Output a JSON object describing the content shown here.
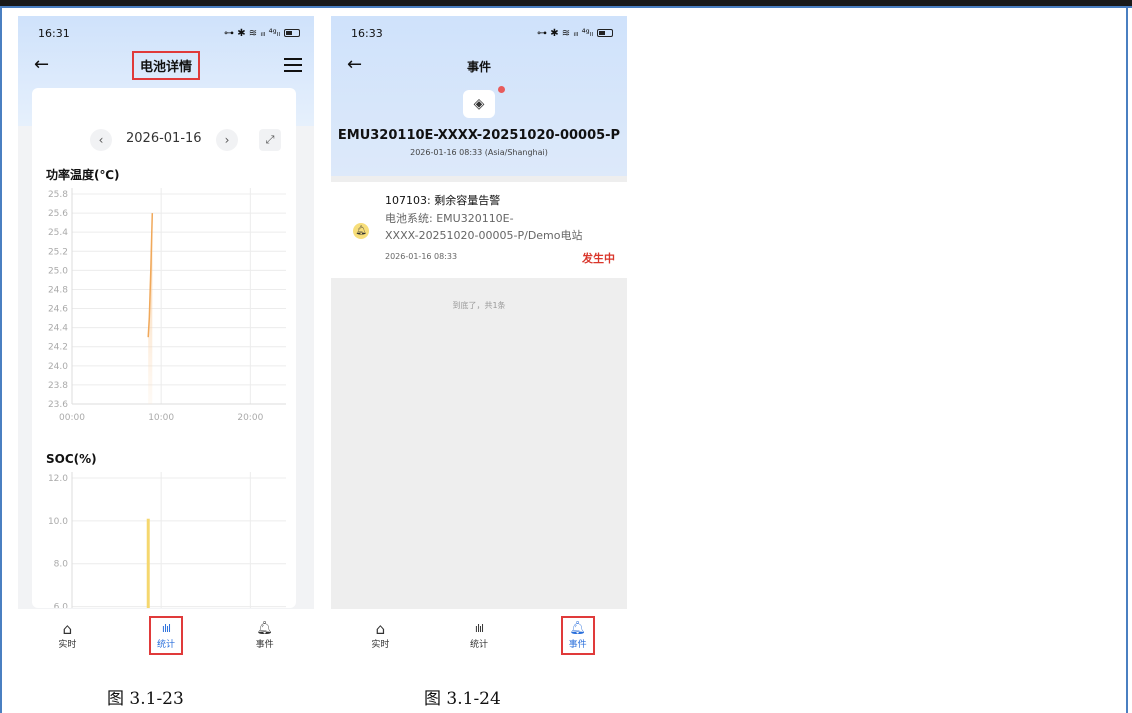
{
  "phone1": {
    "status": {
      "time": "16:31",
      "icons": "⊶ ✱ ≋ ᵢₗₗ ⁴ᵍₗₗ"
    },
    "nav": {
      "title": "电池详情"
    },
    "date": {
      "value": "2026-01-16",
      "prev": "‹",
      "next": "›",
      "expand": "⤢"
    },
    "power_temp": {
      "title": "功率温度(℃)",
      "y_ticks": [
        "25.8",
        "25.6",
        "25.4",
        "25.2",
        "25.0",
        "24.8",
        "24.6",
        "24.4",
        "24.2",
        "24.0",
        "23.8",
        "23.6"
      ],
      "x_ticks": [
        "00:00",
        "10:00",
        "20:00"
      ]
    },
    "soc": {
      "title": "SOC(%)",
      "y_ticks": [
        "12.0",
        "10.0",
        "8.0",
        "6.0"
      ]
    },
    "tabs": [
      {
        "label": "实时",
        "icon": "⌂"
      },
      {
        "label": "统计",
        "icon": "ılıl"
      },
      {
        "label": "事件",
        "icon": "🔔︎"
      }
    ],
    "active_tab": 1,
    "highlight_color": "#e03a3a",
    "accent_color": "#2a6fdb"
  },
  "chart_data": [
    {
      "type": "line",
      "title": "功率温度(℃)",
      "xlabel": "",
      "ylabel": "",
      "x_ticks": [
        "00:00",
        "10:00",
        "20:00"
      ],
      "ylim": [
        23.6,
        25.8
      ],
      "series": [
        {
          "x": [
            "08:33",
            "08:40",
            "08:50",
            "09:00"
          ],
          "values": [
            24.3,
            24.5,
            25.0,
            25.6
          ]
        }
      ],
      "color": "#f0a85a",
      "grid": true
    },
    {
      "type": "bar",
      "title": "SOC(%)",
      "xlabel": "",
      "ylabel": "",
      "ylim": [
        5.0,
        12.0
      ],
      "categories": [
        "08:33"
      ],
      "values": [
        10.1
      ],
      "color": "#f5d76e",
      "grid": true
    }
  ],
  "phone2": {
    "status": {
      "time": "16:33",
      "icons": "⊶ ✱ ≋ ᵢₗₗ ⁴ᵍₗₗ"
    },
    "nav": {
      "title": "事件"
    },
    "device": {
      "id": "EMU320110E-XXXX-20251020-00005-P",
      "time": "2026-01-16 08:33 (Asia/Shanghai)",
      "icon": "◈"
    },
    "event": {
      "title": "107103: 剩余容量告警",
      "desc_line1": "电池系统: EMU320110E-",
      "desc_line2": "XXXX-20251020-00005-P/Demo电站",
      "time": "2026-01-16 08:33",
      "status": "发生中",
      "icon": "🔔︎"
    },
    "end_text": "到底了，共1条",
    "tabs": [
      {
        "label": "实时",
        "icon": "⌂"
      },
      {
        "label": "统计",
        "icon": "ılıl"
      },
      {
        "label": "事件",
        "icon": "🔔︎"
      }
    ],
    "active_tab": 2
  },
  "captions": [
    "图 3.1-23",
    "图 3.1-24"
  ]
}
